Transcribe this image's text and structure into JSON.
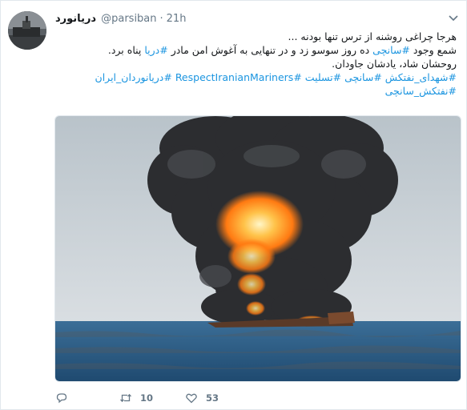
{
  "tweet": {
    "author_name": "دریانورد",
    "handle": "@parsiban",
    "separator": "·",
    "time": "21h",
    "lines": [
      [
        {
          "t": "هرجا چراغی روشنه از ترس تنها بودنه ..."
        }
      ],
      [
        {
          "t": "شمع وجود "
        },
        {
          "t": "#سانچی",
          "tag": true
        },
        {
          "t": " ده روز سوسو زد و در تنهایی به آغوش امن مادر "
        },
        {
          "t": "#دریا",
          "tag": true
        },
        {
          "t": " پناه برد."
        }
      ],
      [
        {
          "t": "روحشان شاد، یادشان جاودان."
        }
      ],
      [
        {
          "t": "#شهدای_نفتکش",
          "tag": true
        },
        {
          "t": " "
        },
        {
          "t": "#سانچی",
          "tag": true
        },
        {
          "t": " "
        },
        {
          "t": "#تسلیت",
          "tag": true
        },
        {
          "t": "  "
        },
        {
          "t": "#RespectIranianMariners",
          "tag": true
        },
        {
          "t": " "
        },
        {
          "t": "#دریانوردان_ایران",
          "tag": true
        }
      ],
      [
        {
          "t": "#نفتکش_سانچی",
          "tag": true
        }
      ]
    ],
    "retweet_count": "10",
    "like_count": "53"
  },
  "colors": {
    "link": "#1b95e0",
    "muted": "#657786",
    "sea": "#2a5f8c",
    "sky": "#c9d2d8",
    "smoke": "#2b2b2d",
    "fire": "#ff8a1c"
  },
  "icons": [
    "chevron-down-icon",
    "reply-icon",
    "retweet-icon",
    "heart-icon"
  ]
}
